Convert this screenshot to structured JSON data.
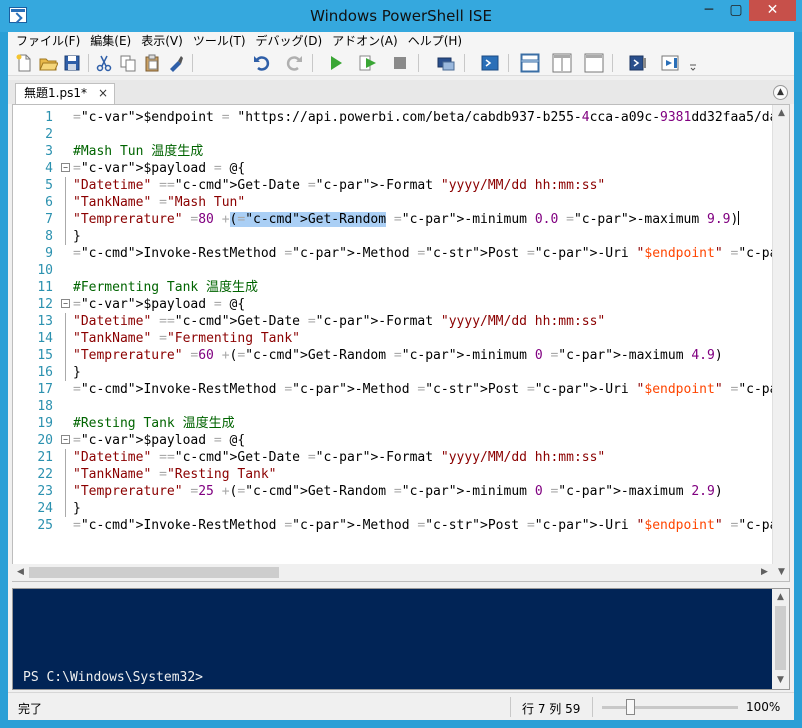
{
  "window": {
    "title": "Windows PowerShell ISE",
    "min": "─",
    "max": "▢",
    "close": "✕"
  },
  "menu": [
    "ファイル(F)",
    "編集(E)",
    "表示(V)",
    "ツール(T)",
    "デバッグ(D)",
    "アドオン(A)",
    "ヘルプ(H)"
  ],
  "toolbar": {
    "icons": [
      "new-icon",
      "open-icon",
      "save-icon",
      "cut-icon",
      "copy-icon",
      "paste-icon",
      "clear-icon",
      "undo-icon",
      "redo-icon",
      "run-icon",
      "run-selection-icon",
      "stop-icon",
      "remote-icon",
      "powershell-icon",
      "layout-top-icon",
      "layout-right-icon",
      "layout-max-icon",
      "commands-icon",
      "addon-icon"
    ]
  },
  "tab": {
    "label": "無題1.ps1*",
    "close": "×",
    "collapse": "▲"
  },
  "editor": {
    "lines": [
      {
        "n": "1",
        "code": "$endpoint = \"https://api.powerbi.com/beta/cabdb937-b255-4cca-a09c-9381dd32faa5/datasets/"
      },
      {
        "n": "2",
        "code": ""
      },
      {
        "n": "3",
        "code": "#Mash Tun 温度生成"
      },
      {
        "n": "4",
        "code": "$payload = @{"
      },
      {
        "n": "5",
        "code": "\"Datetime\" =Get-Date -Format \"yyyy/MM/dd hh:mm:ss\""
      },
      {
        "n": "6",
        "code": "\"TankName\" =\"Mash Tun\""
      },
      {
        "n": "7",
        "code": "\"Temprerature\" =80 +(Get-Random -minimum 0.0 -maximum 9.9)"
      },
      {
        "n": "8",
        "code": "}"
      },
      {
        "n": "9",
        "code": "Invoke-RestMethod -Method Post -Uri \"$endpoint\" -Body (ConvertTo-Json @($payload))"
      },
      {
        "n": "10",
        "code": ""
      },
      {
        "n": "11",
        "code": "#Fermenting Tank 温度生成"
      },
      {
        "n": "12",
        "code": "$payload = @{"
      },
      {
        "n": "13",
        "code": "\"Datetime\" =Get-Date -Format \"yyyy/MM/dd hh:mm:ss\""
      },
      {
        "n": "14",
        "code": "\"TankName\" =\"Fermenting Tank\""
      },
      {
        "n": "15",
        "code": "\"Temprerature\" =60 +(Get-Random -minimum 0 -maximum 4.9)"
      },
      {
        "n": "16",
        "code": "}"
      },
      {
        "n": "17",
        "code": "Invoke-RestMethod -Method Post -Uri \"$endpoint\" -Body (ConvertTo-Json @($payload))"
      },
      {
        "n": "18",
        "code": ""
      },
      {
        "n": "19",
        "code": "#Resting Tank 温度生成"
      },
      {
        "n": "20",
        "code": "$payload = @{"
      },
      {
        "n": "21",
        "code": "\"Datetime\" =Get-Date -Format \"yyyy/MM/dd hh:mm:ss\""
      },
      {
        "n": "22",
        "code": "\"TankName\" =\"Resting Tank\""
      },
      {
        "n": "23",
        "code": "\"Temprerature\" =25 +(Get-Random -minimum 0 -maximum 2.9)"
      },
      {
        "n": "24",
        "code": "}"
      },
      {
        "n": "25",
        "code": "Invoke-RestMethod -Method Post -Uri \"$endpoint\" -Body (ConvertTo-Json @($payload))"
      }
    ]
  },
  "console": {
    "prompt": "PS C:\\Windows\\System32>"
  },
  "statusbar": {
    "status": "完了",
    "position": "行 7 列 59",
    "zoom": "100%",
    "zoom_level": 1.0
  }
}
